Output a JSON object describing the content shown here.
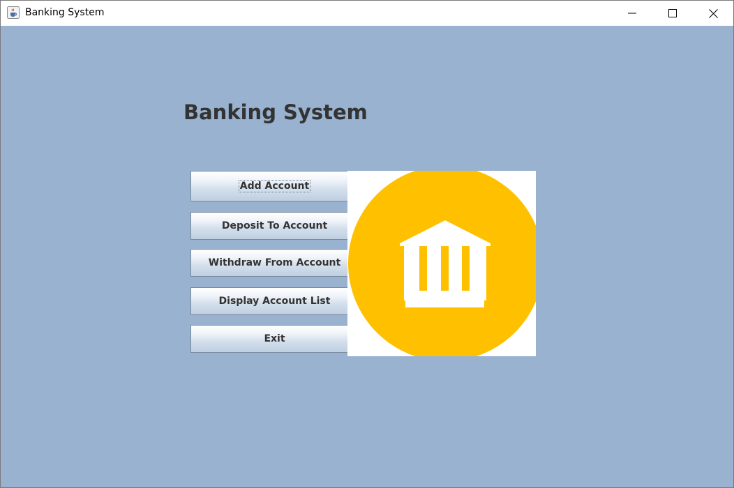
{
  "window": {
    "title": "Banking System",
    "icon": "java-cup-icon",
    "controls": {
      "minimize_icon": "minimize-icon",
      "maximize_icon": "maximize-icon",
      "close_icon": "close-icon"
    }
  },
  "main": {
    "heading": "Banking System",
    "buttons": [
      {
        "label": "Add Account",
        "focused": true
      },
      {
        "label": "Deposit To Account",
        "focused": false
      },
      {
        "label": "Withdraw From Account",
        "focused": false
      },
      {
        "label": "Display Account List",
        "focused": false
      },
      {
        "label": "Exit",
        "focused": false
      }
    ],
    "image": {
      "icon": "bank-icon",
      "circle_color": "#ffc000",
      "building_color": "#ffffff"
    }
  },
  "colors": {
    "background": "#98b2d0",
    "heading": "#333333",
    "button_text": "#333333"
  }
}
